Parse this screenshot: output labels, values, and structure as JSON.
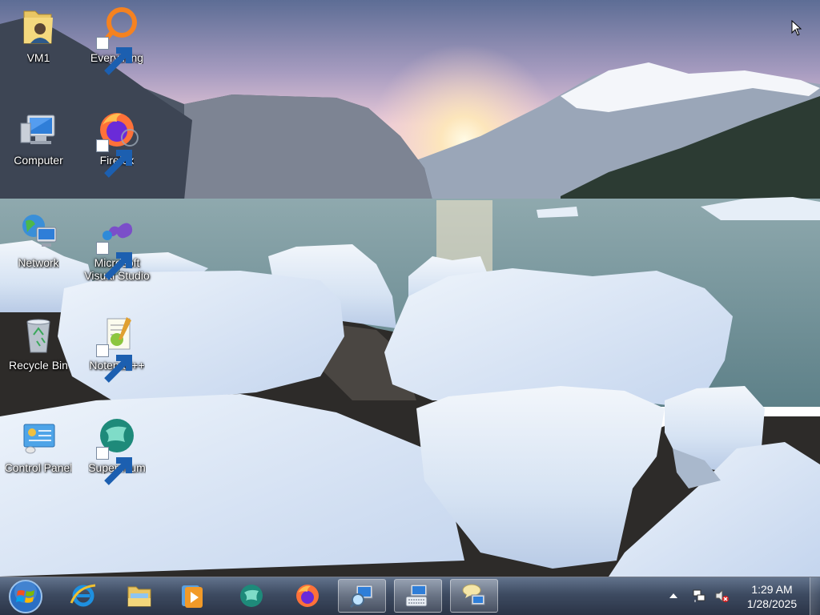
{
  "desktop": {
    "icons": [
      {
        "label": "VM1",
        "icon": "user-folder-icon",
        "shortcut": false
      },
      {
        "label": "Everything",
        "icon": "everything-search-icon",
        "shortcut": true
      },
      {
        "label": "Computer",
        "icon": "computer-icon",
        "shortcut": false
      },
      {
        "label": "Firefox",
        "icon": "firefox-icon",
        "shortcut": true
      },
      {
        "label": "Network",
        "icon": "network-globe-icon",
        "shortcut": false
      },
      {
        "label": "Microsoft Visual Studio",
        "icon": "visual-studio-icon",
        "shortcut": true
      },
      {
        "label": "Recycle Bin",
        "icon": "recycle-bin-icon",
        "shortcut": false
      },
      {
        "label": "Notepad++",
        "icon": "notepadpp-icon",
        "shortcut": true
      },
      {
        "label": "Control Panel",
        "icon": "control-panel-icon",
        "shortcut": false
      },
      {
        "label": "Supermium",
        "icon": "supermium-icon",
        "shortcut": true
      }
    ]
  },
  "taskbar": {
    "start": {
      "icon": "windows-start-orb-icon"
    },
    "pinned": [
      {
        "name": "Internet Explorer",
        "icon": "internet-explorer-icon",
        "open": false
      },
      {
        "name": "Windows Explorer",
        "icon": "file-explorer-icon",
        "open": false
      },
      {
        "name": "Windows Media Player",
        "icon": "media-player-icon",
        "open": false
      },
      {
        "name": "Supermium",
        "icon": "supermium-icon",
        "open": false
      },
      {
        "name": "Firefox",
        "icon": "firefox-icon",
        "open": false
      },
      {
        "name": "Magnifier",
        "icon": "magnifier-icon",
        "open": true
      },
      {
        "name": "On-Screen Keyboard",
        "icon": "keyboard-icon",
        "open": true
      },
      {
        "name": "Narrator",
        "icon": "narrator-icon",
        "open": true
      }
    ],
    "tray": {
      "icons": [
        "show-hidden-icons-chevron-icon",
        "network-status-icon",
        "volume-muted-icon"
      ],
      "time": "1:29 AM",
      "date": "1/28/2025"
    }
  },
  "colors": {
    "taskbar_bg": "#2a3a55",
    "label_text": "#ffffff"
  }
}
